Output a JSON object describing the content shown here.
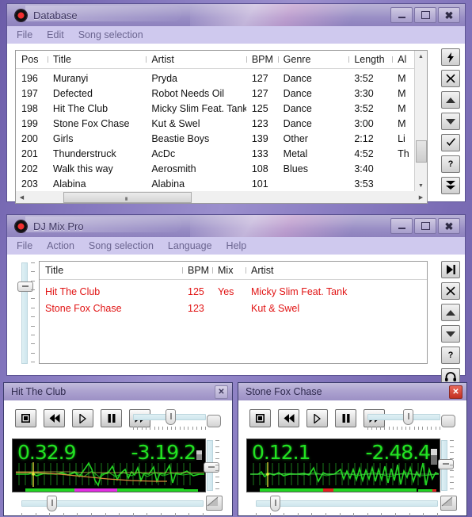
{
  "desktop": {
    "background": "#8376bd"
  },
  "database_window": {
    "title": "Database",
    "icon": "record-icon",
    "buttons": {
      "minimize": "minimize-icon",
      "maximize": "maximize-icon",
      "close": "close-icon"
    },
    "menu": [
      "File",
      "Edit",
      "Song selection"
    ],
    "columns": [
      "Pos",
      "Title",
      "Artist",
      "BPM",
      "Genre",
      "Length",
      "Al"
    ],
    "rows": [
      {
        "pos": "196",
        "title": "Muranyi",
        "artist": "Pryda",
        "bpm": "127",
        "genre": "Dance",
        "length": "3:52",
        "al": "M"
      },
      {
        "pos": "197",
        "title": "Defected",
        "artist": "Robot Needs Oil",
        "bpm": "127",
        "genre": "Dance",
        "length": "3:30",
        "al": "M"
      },
      {
        "pos": "198",
        "title": "Hit The Club",
        "artist": "Micky Slim Feat. Tank",
        "bpm": "125",
        "genre": "Dance",
        "length": "3:52",
        "al": "M"
      },
      {
        "pos": "199",
        "title": "Stone Fox Chase",
        "artist": "Kut & Swel",
        "bpm": "123",
        "genre": "Dance",
        "length": "3:00",
        "al": "M"
      },
      {
        "pos": "200",
        "title": "Girls",
        "artist": "Beastie Boys",
        "bpm": "139",
        "genre": "Other",
        "length": "2:12",
        "al": "Li"
      },
      {
        "pos": "201",
        "title": "Thunderstruck",
        "artist": "AcDc",
        "bpm": "133",
        "genre": "Metal",
        "length": "4:52",
        "al": "Th"
      },
      {
        "pos": "202",
        "title": "Walk this way",
        "artist": "Aerosmith",
        "bpm": "108",
        "genre": "Blues",
        "length": "3:40",
        "al": ""
      },
      {
        "pos": "203",
        "title": "Alabina",
        "artist": "Alabina",
        "bpm": "101",
        "genre": "",
        "length": "3:53",
        "al": ""
      }
    ],
    "toolbar": [
      {
        "name": "lightning-icon",
        "glyph": "⚡"
      },
      {
        "name": "delete-x-icon",
        "glyph": "✕"
      },
      {
        "name": "move-up-icon",
        "glyph": "▲"
      },
      {
        "name": "move-down-icon",
        "glyph": "▼"
      },
      {
        "name": "check-icon",
        "glyph": "✓"
      },
      {
        "name": "help-question-icon",
        "glyph": "?"
      },
      {
        "name": "double-down-icon",
        "glyph": "↓"
      }
    ]
  },
  "djmix_window": {
    "title": "DJ Mix Pro",
    "icon": "record-icon",
    "buttons": {
      "minimize": "minimize-icon",
      "maximize": "maximize-icon",
      "close": "close-icon"
    },
    "menu": [
      "File",
      "Action",
      "Song selection",
      "Language",
      "Help"
    ],
    "columns": [
      "Title",
      "BPM",
      "Mix",
      "Artist",
      ""
    ],
    "rows": [
      {
        "title": "Hit The Club",
        "bpm": "125",
        "mix": "Yes",
        "artist": "Micky Slim Feat. Tank"
      },
      {
        "title": "Stone Fox Chase",
        "bpm": "123",
        "mix": "",
        "artist": "Kut & Swel"
      }
    ],
    "crossfader": {
      "name": "mix-level-slider",
      "value": 78
    },
    "toolbar": [
      {
        "name": "skip-next-icon",
        "glyph": "⏭"
      },
      {
        "name": "delete-x-icon",
        "glyph": "✕"
      },
      {
        "name": "move-up-icon",
        "glyph": "▲"
      },
      {
        "name": "move-down-icon",
        "glyph": "▼"
      },
      {
        "name": "help-question-icon",
        "glyph": "?"
      },
      {
        "name": "headphones-icon",
        "glyph": "♫"
      }
    ]
  },
  "player_left": {
    "title": "Hit The Club",
    "active": false,
    "close_label": "✕",
    "transport": [
      {
        "name": "stop-button",
        "glyph": "stop"
      },
      {
        "name": "rewind-button",
        "glyph": "rew"
      },
      {
        "name": "play-button",
        "glyph": "play"
      },
      {
        "name": "pause-button",
        "glyph": "pause"
      },
      {
        "name": "forward-button",
        "glyph": "ffwd"
      }
    ],
    "top_slider_value": 52,
    "elapsed_time": "0.32.9",
    "remaining_time": "-3.19.2",
    "pitch_slider_value": 64,
    "bottom_slider_value": 14,
    "progress_markers": {
      "intro_pct": 28,
      "mix_pct": 52,
      "outro_pct": 97
    }
  },
  "player_right": {
    "title": "Stone Fox Chase",
    "active": true,
    "close_label": "✕",
    "transport": [
      {
        "name": "stop-button",
        "glyph": "stop"
      },
      {
        "name": "rewind-button",
        "glyph": "rew"
      },
      {
        "name": "play-button",
        "glyph": "play"
      },
      {
        "name": "pause-button",
        "glyph": "pause"
      },
      {
        "name": "forward-button",
        "glyph": "ffwd"
      }
    ],
    "top_slider_value": 56,
    "elapsed_time": "0.12.1",
    "remaining_time": "-2.48.4",
    "pitch_slider_value": 54,
    "bottom_slider_value": 8,
    "progress_markers": {
      "cue_pct": 40,
      "end_pct": 92
    }
  },
  "colors": {
    "waveform_green": "#22d422",
    "accent_red": "#e11414",
    "title_gradient_start": "#b9b2d6",
    "title_gradient_end": "#8d81bd",
    "menubar": "#cfc9ee"
  }
}
